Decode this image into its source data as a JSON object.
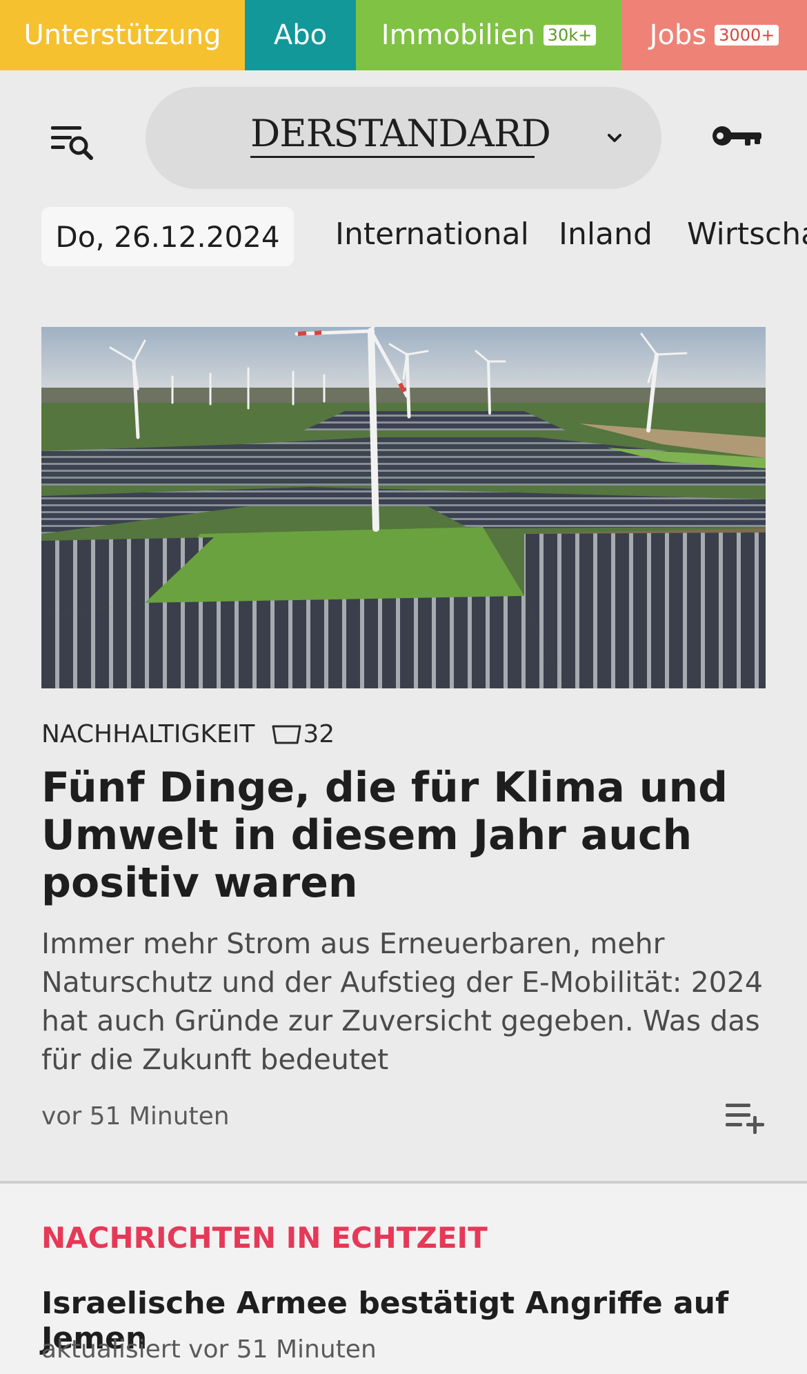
{
  "topbar": {
    "support_label": "Unterstützung",
    "abo_label": "Abo",
    "immobilien_label": "Immobilien",
    "immobilien_badge": "30k+",
    "jobs_label": "Jobs",
    "jobs_badge": "3000+",
    "colors": {
      "support": "#f5c12e",
      "abo": "#13989a",
      "immobilien": "#80c244",
      "jobs": "#ee8277"
    }
  },
  "header": {
    "logo_text": "DERSTANDARD",
    "menu_icon": "menu-search-icon",
    "key_icon": "key-icon"
  },
  "nav": {
    "date": "Do, 26.12.2024",
    "items": [
      "International",
      "Inland",
      "Wirtscha"
    ]
  },
  "article": {
    "kicker": "NACHHALTIGKEIT",
    "comment_count": "32",
    "headline": "Fünf Dinge, die für Klima und Umwelt in diesem Jahr auch positiv waren",
    "lead": "Immer mehr Strom aus Erneuerbaren, mehr Naturschutz und der Aufstieg der E-Mobilität: 2024 hat auch Gründe zur Zuversicht gegeben. Was das für die Zukunft bedeutet",
    "time": "vor 51 Minuten"
  },
  "live": {
    "section_title": "NACHRICHTEN IN ECHTZEIT",
    "accent_color": "#e53957",
    "headline": "Israelische Armee bestätigt Angriffe auf Jemen",
    "time": "aktualisiert vor 51 Minuten"
  }
}
